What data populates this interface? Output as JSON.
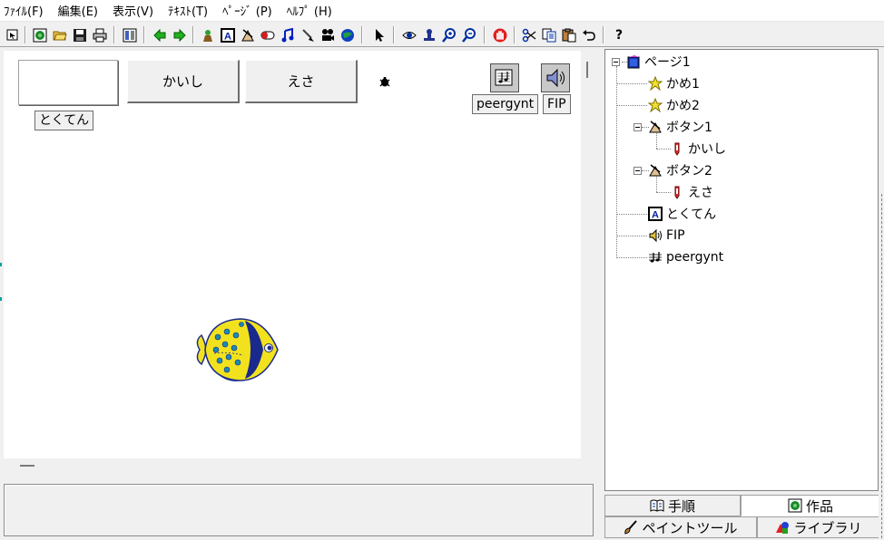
{
  "menu": [
    "ﾌｧｲﾙ(F)",
    "編集(E)",
    "表示(V)",
    "ﾃｷｽﾄ(T)",
    "ﾍﾟｰｼﾞ (P)",
    "ﾍﾙﾌﾟ (H)"
  ],
  "toolbar": {
    "icons": [
      "select-arrow-icon",
      "preview-icon",
      "open-folder-icon",
      "save-icon",
      "print-icon",
      "layout-icon",
      "prev-page-icon",
      "next-page-icon",
      "character-icon",
      "text-icon",
      "button-icon",
      "capsule-icon",
      "music-icon",
      "brush-icon",
      "movie-icon",
      "globe-icon",
      "pointer-icon",
      "eye-icon",
      "stamp-icon",
      "zoom-in-icon",
      "zoom-out-icon",
      "stop-hand-icon",
      "cut-icon",
      "copy-icon",
      "paste-icon",
      "undo-icon",
      "help-icon"
    ],
    "help_label": "?"
  },
  "stage": {
    "button1_label": "かいし",
    "button2_label": "えさ",
    "score_label": "とくてん",
    "music_label": "peergynt",
    "sound_label": "FIP"
  },
  "tree": {
    "items": [
      {
        "label": "ページ1",
        "icon": "page-icon"
      },
      {
        "label": "かめ1",
        "icon": "character-icon"
      },
      {
        "label": "かめ2",
        "icon": "character-icon"
      },
      {
        "label": "ボタン1",
        "icon": "button-icon"
      },
      {
        "label": "かいし",
        "icon": "action-icon"
      },
      {
        "label": "ボタン2",
        "icon": "button-icon"
      },
      {
        "label": "えさ",
        "icon": "action-icon"
      },
      {
        "label": "とくてん",
        "icon": "text-icon"
      },
      {
        "label": "FIP",
        "icon": "sound-icon"
      },
      {
        "label": "peergynt",
        "icon": "music-icon"
      }
    ]
  },
  "tabs": {
    "steps": "手順",
    "works": "作品",
    "paint_tool": "ペイントツール",
    "library": "ライブラリ"
  },
  "colors": {
    "fish_yellow": "#f2e21e",
    "fish_blue": "#1a2a8c",
    "accent": "#0000ff"
  }
}
